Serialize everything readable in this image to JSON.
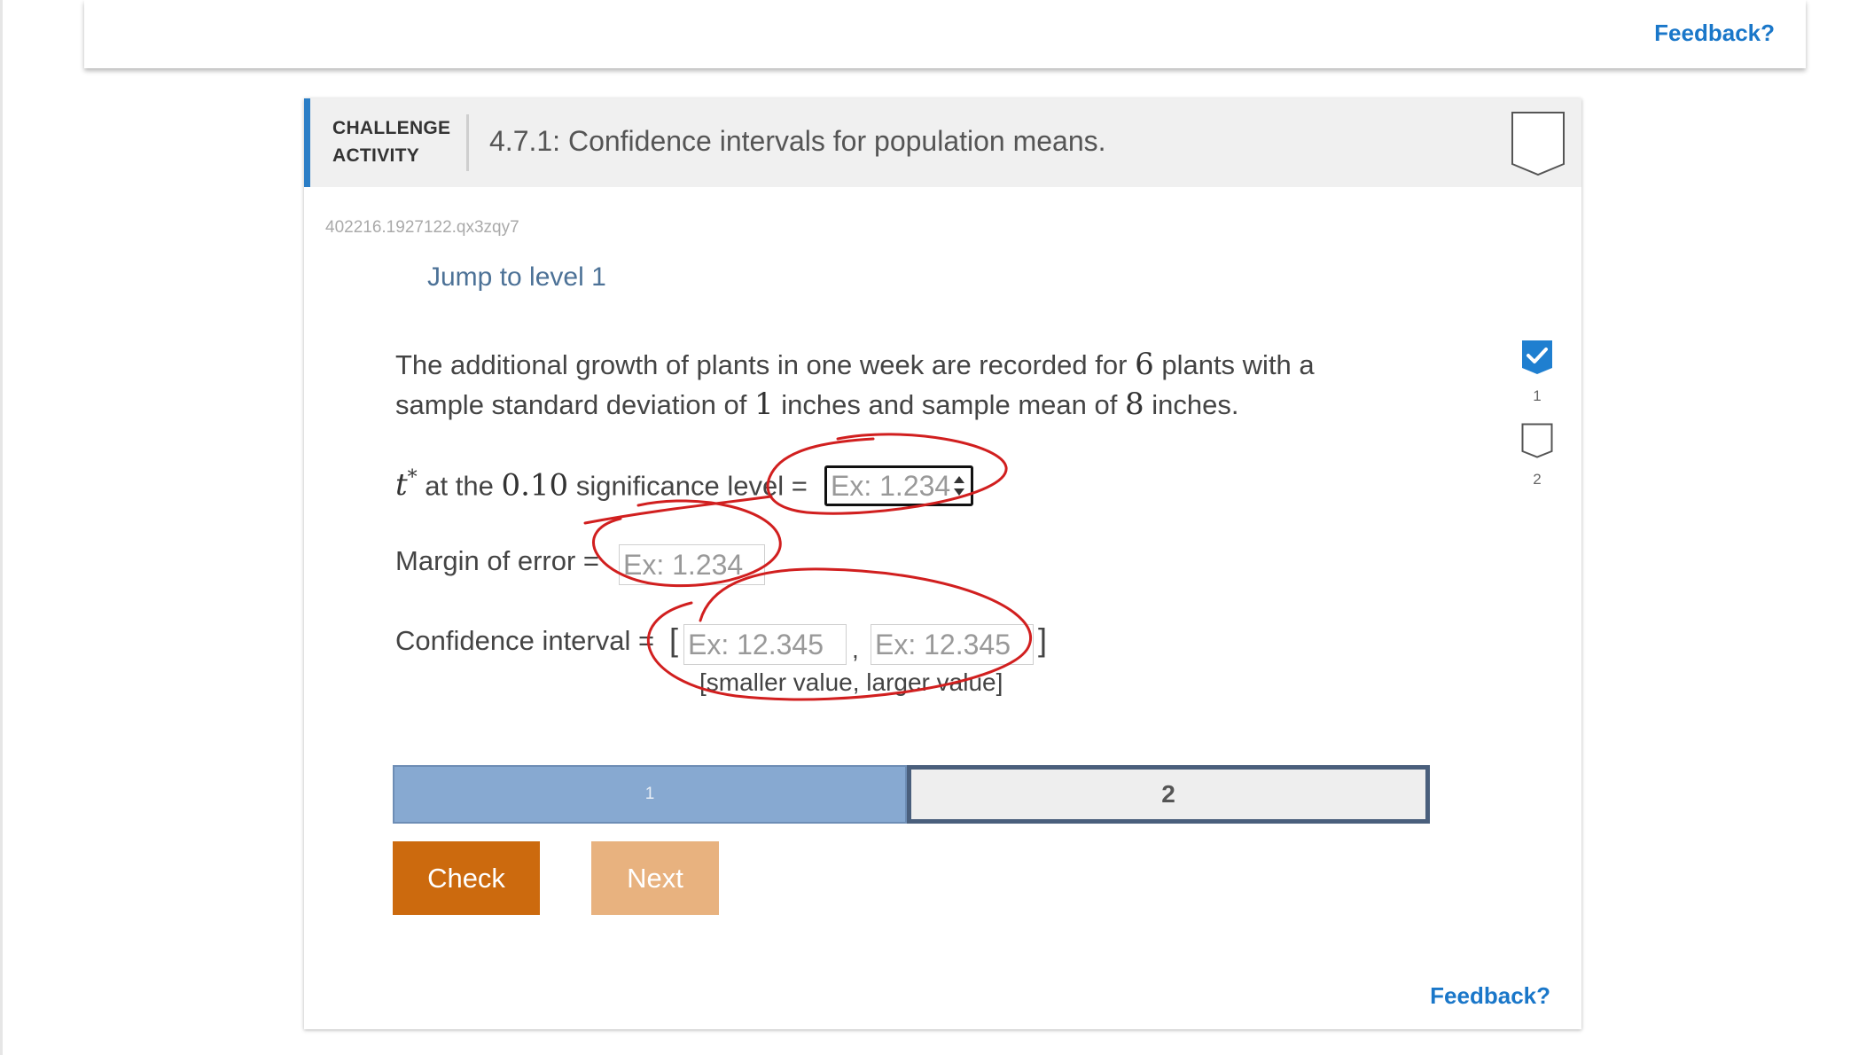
{
  "topbar": {
    "feedback_label": "Feedback?"
  },
  "header": {
    "challenge_line1": "CHALLENGE",
    "challenge_line2": "ACTIVITY",
    "title": "4.7.1: Confidence intervals for population means."
  },
  "activity_id": "402216.1927122.qx3zqy7",
  "jump_link": "Jump to level 1",
  "problem": {
    "text1": "The additional growth of plants in one week are recorded for",
    "n": "6",
    "text2": "plants with a sample standard deviation of",
    "sd": "1",
    "text3": "inches and sample mean of",
    "mean": "8",
    "text4": "inches."
  },
  "tstar_row": {
    "symbol": "t",
    "sup": "*",
    "text_at": "at the",
    "level": "0.10",
    "text_after": "significance level =",
    "placeholder": "Ex: 1.234"
  },
  "margin_row": {
    "label": "Margin of error =",
    "placeholder": "Ex: 1.234"
  },
  "ci_row": {
    "label": "Confidence interval =",
    "open_bracket": "[",
    "comma": ",",
    "close_bracket": "]",
    "placeholder_low": "Ex: 12.345",
    "placeholder_high": "Ex: 12.345",
    "hint": "[smaller value, larger value]"
  },
  "levels": {
    "level1": "1",
    "level2": "2"
  },
  "buttons": {
    "check": "Check",
    "next": "Next"
  },
  "card_feedback_label": "Feedback?",
  "tracker": {
    "item1": "1",
    "item2": "2"
  },
  "colors": {
    "accent_blue": "#2b7ec6",
    "link_blue": "#1a77c9",
    "check_orange": "#cc6a0e",
    "next_orange_light": "#e8b27f",
    "annotation_red": "#d11f1f"
  }
}
